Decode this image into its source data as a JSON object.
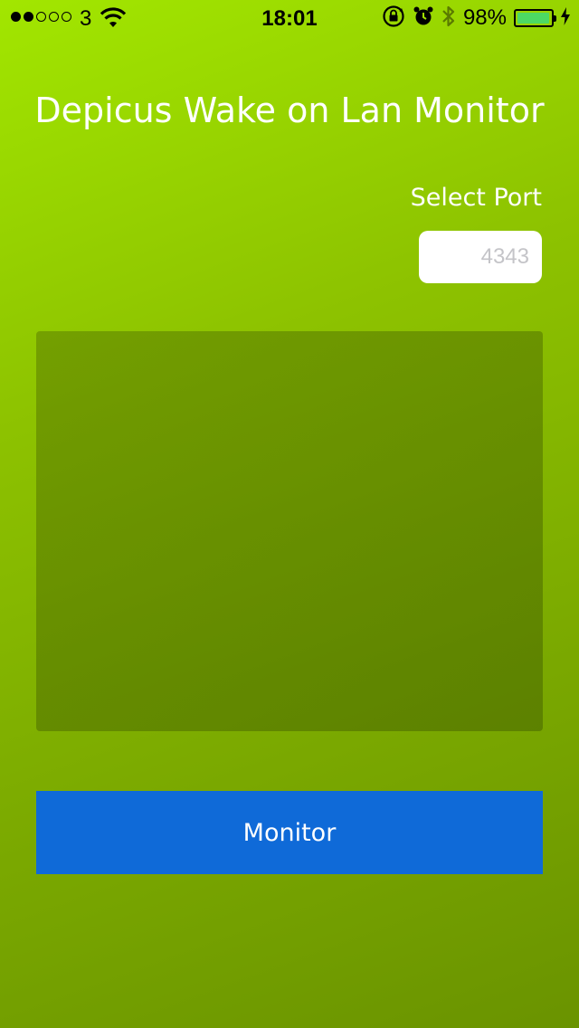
{
  "status_bar": {
    "signal_bars_filled": 2,
    "signal_bars_total": 5,
    "carrier": "3",
    "time": "18:01",
    "battery_percent": "98%",
    "battery_level": 0.98,
    "battery_color": "#4cd964",
    "icons": [
      "wifi-icon",
      "rotation-lock-icon",
      "alarm-icon",
      "bluetooth-icon",
      "charging-icon"
    ]
  },
  "main": {
    "title": "Depicus Wake on Lan Monitor",
    "port_label": "Select Port",
    "port_input": {
      "value": "",
      "placeholder": "4343"
    },
    "monitor_button_label": "Monitor"
  },
  "colors": {
    "background_top": "#a2e600",
    "background_bottom": "#6a9300",
    "button": "#0f6ad8",
    "text": "#ffffff"
  }
}
